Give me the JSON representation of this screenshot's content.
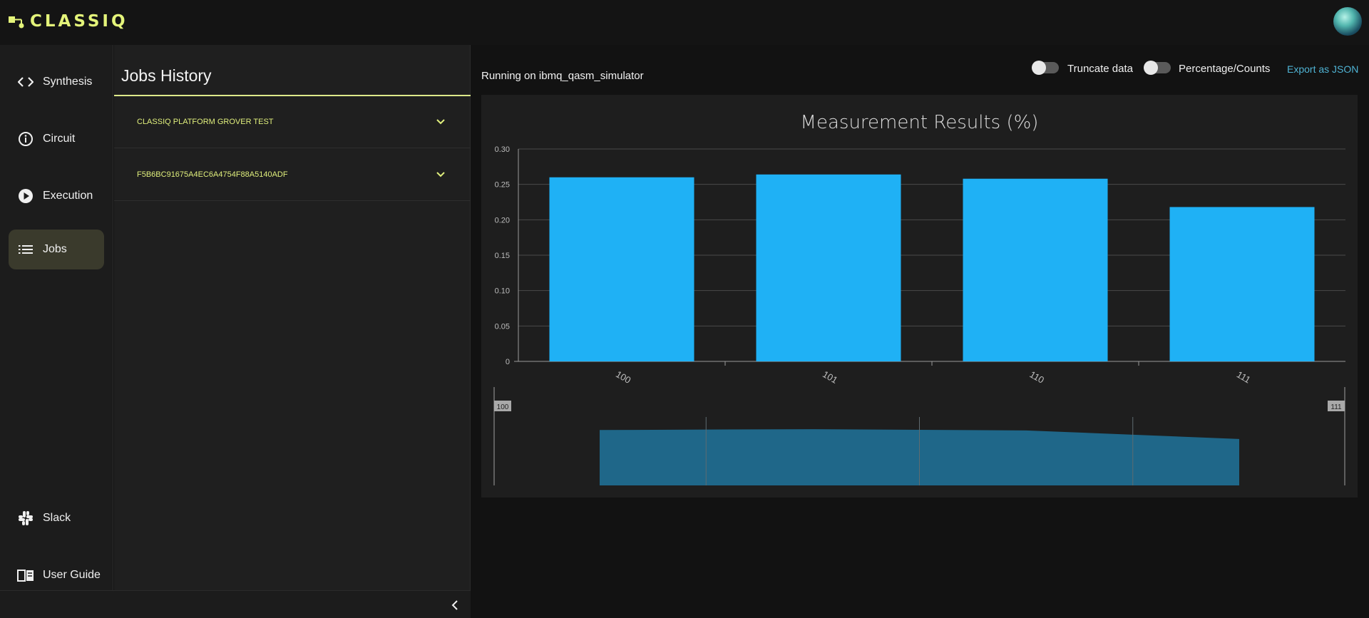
{
  "app": {
    "logo_text": "CLASSIQ"
  },
  "nav": {
    "items": [
      {
        "label": "Synthesis",
        "icon": "code-icon"
      },
      {
        "label": "Circuit",
        "icon": "info-icon"
      },
      {
        "label": "Execution",
        "icon": "play-icon"
      },
      {
        "label": "Jobs",
        "icon": "list-icon",
        "active": true
      }
    ],
    "bottom_items": [
      {
        "label": "Slack",
        "icon": "slack-icon"
      },
      {
        "label": "User Guide",
        "icon": "book-icon"
      }
    ]
  },
  "jobs": {
    "title": "Jobs History",
    "items": [
      {
        "name": "CLASSIQ PLATFORM GROVER TEST"
      },
      {
        "name": "F5B6BC91675A4EC6A4754F88A5140ADF"
      }
    ]
  },
  "main": {
    "running_text": "Running on ibmq_qasm_simulator",
    "truncate_label": "Truncate data",
    "percentage_label": "Percentage/Counts",
    "export_label": "Export as JSON"
  },
  "colors": {
    "accent": "#e4f47a",
    "bar": "#1fb1f5",
    "range_fill": "#1f6789",
    "link": "#4fb3d4"
  },
  "chart_data": {
    "type": "bar",
    "title": "Measurement Results (%)",
    "categories": [
      "100",
      "101",
      "110",
      "111"
    ],
    "values": [
      0.26,
      0.264,
      0.258,
      0.218
    ],
    "ylim": [
      0,
      0.3
    ],
    "yticks": [
      "0",
      "0.05",
      "0.10",
      "0.15",
      "0.20",
      "0.25",
      "0.30"
    ],
    "grid": true,
    "range_slider": {
      "start_label": "100",
      "end_label": "111"
    }
  }
}
